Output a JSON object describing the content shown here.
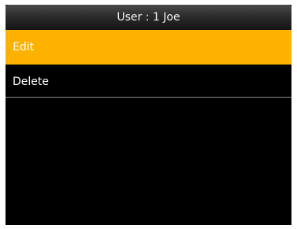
{
  "header": {
    "title": "User : 1 Joe"
  },
  "menu": {
    "items": [
      {
        "label": "Edit",
        "selected": true
      },
      {
        "label": "Delete",
        "selected": false
      }
    ]
  },
  "colors": {
    "selection": "#fdb200",
    "background": "#000000",
    "text": "#ffffff"
  }
}
